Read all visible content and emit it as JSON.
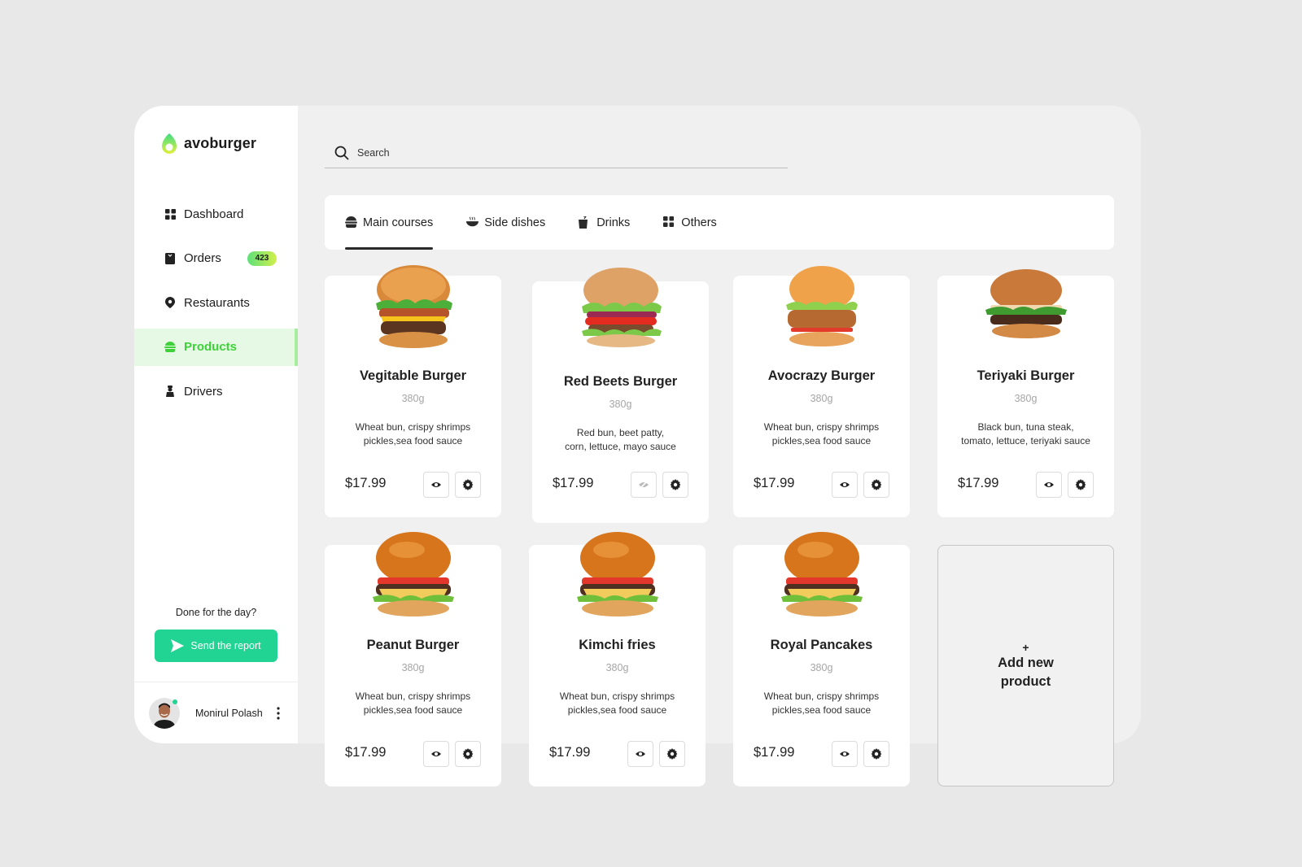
{
  "brand": {
    "name": "avoburger",
    "accent": "#3fd13a",
    "cta_color": "#22d493"
  },
  "sidebar": {
    "items": [
      {
        "label": "Dashboard",
        "icon": "grid-icon",
        "active": false
      },
      {
        "label": "Orders",
        "icon": "clipboard-icon",
        "active": false,
        "badge": "423"
      },
      {
        "label": "Restaurants",
        "icon": "map-pin-icon",
        "active": false
      },
      {
        "label": "Products",
        "icon": "burger-icon",
        "active": true
      },
      {
        "label": "Drivers",
        "icon": "driver-icon",
        "active": false
      }
    ],
    "prompt": "Done for the day?",
    "report_button": "Send the report",
    "user": {
      "name": "Monirul Polash",
      "status": "online"
    }
  },
  "search": {
    "placeholder": "Search",
    "value": ""
  },
  "tabs": [
    {
      "label": "Main courses",
      "icon": "burger-icon",
      "active": true
    },
    {
      "label": "Side dishes",
      "icon": "bowl-icon",
      "active": false
    },
    {
      "label": "Drinks",
      "icon": "cup-icon",
      "active": false
    },
    {
      "label": "Others",
      "icon": "grid-icon",
      "active": false
    }
  ],
  "products": [
    {
      "name": "Vegitable Burger",
      "weight": "380g",
      "desc_line1": "Wheat bun, crispy shrimps",
      "desc_line2": "pickles,sea food sauce",
      "price": "$17.99",
      "visible": true,
      "image": "bacon-cheese-burger"
    },
    {
      "name": "Red Beets Burger",
      "weight": "380g",
      "desc_line1": "Red bun, beet patty,",
      "desc_line2": "corn, lettuce, mayo sauce",
      "price": "$17.99",
      "visible": false,
      "image": "veggie-tomato-burger"
    },
    {
      "name": "Avocrazy Burger",
      "weight": "380g",
      "desc_line1": "Wheat bun, crispy shrimps",
      "desc_line2": "pickles,sea food sauce",
      "price": "$17.99",
      "visible": true,
      "image": "chicken-burger"
    },
    {
      "name": "Teriyaki Burger",
      "weight": "380g",
      "desc_line1": "Black bun, tuna steak,",
      "desc_line2": "tomato, lettuce, teriyaki sauce",
      "price": "$17.99",
      "visible": true,
      "image": "classic-burger"
    },
    {
      "name": "Peanut Burger",
      "weight": "380g",
      "desc_line1": "Wheat bun, crispy shrimps",
      "desc_line2": "pickles,sea food sauce",
      "price": "$17.99",
      "visible": true,
      "image": "glossy-bun-burger"
    },
    {
      "name": "Kimchi fries",
      "weight": "380g",
      "desc_line1": "Wheat bun, crispy shrimps",
      "desc_line2": "pickles,sea food sauce",
      "price": "$17.99",
      "visible": true,
      "image": "glossy-bun-burger"
    },
    {
      "name": "Royal Pancakes",
      "weight": "380g",
      "desc_line1": "Wheat bun, crispy shrimps",
      "desc_line2": "pickles,sea food sauce",
      "price": "$17.99",
      "visible": true,
      "image": "glossy-bun-burger"
    }
  ],
  "add_product": {
    "plus": "+",
    "label": "Add new product"
  }
}
